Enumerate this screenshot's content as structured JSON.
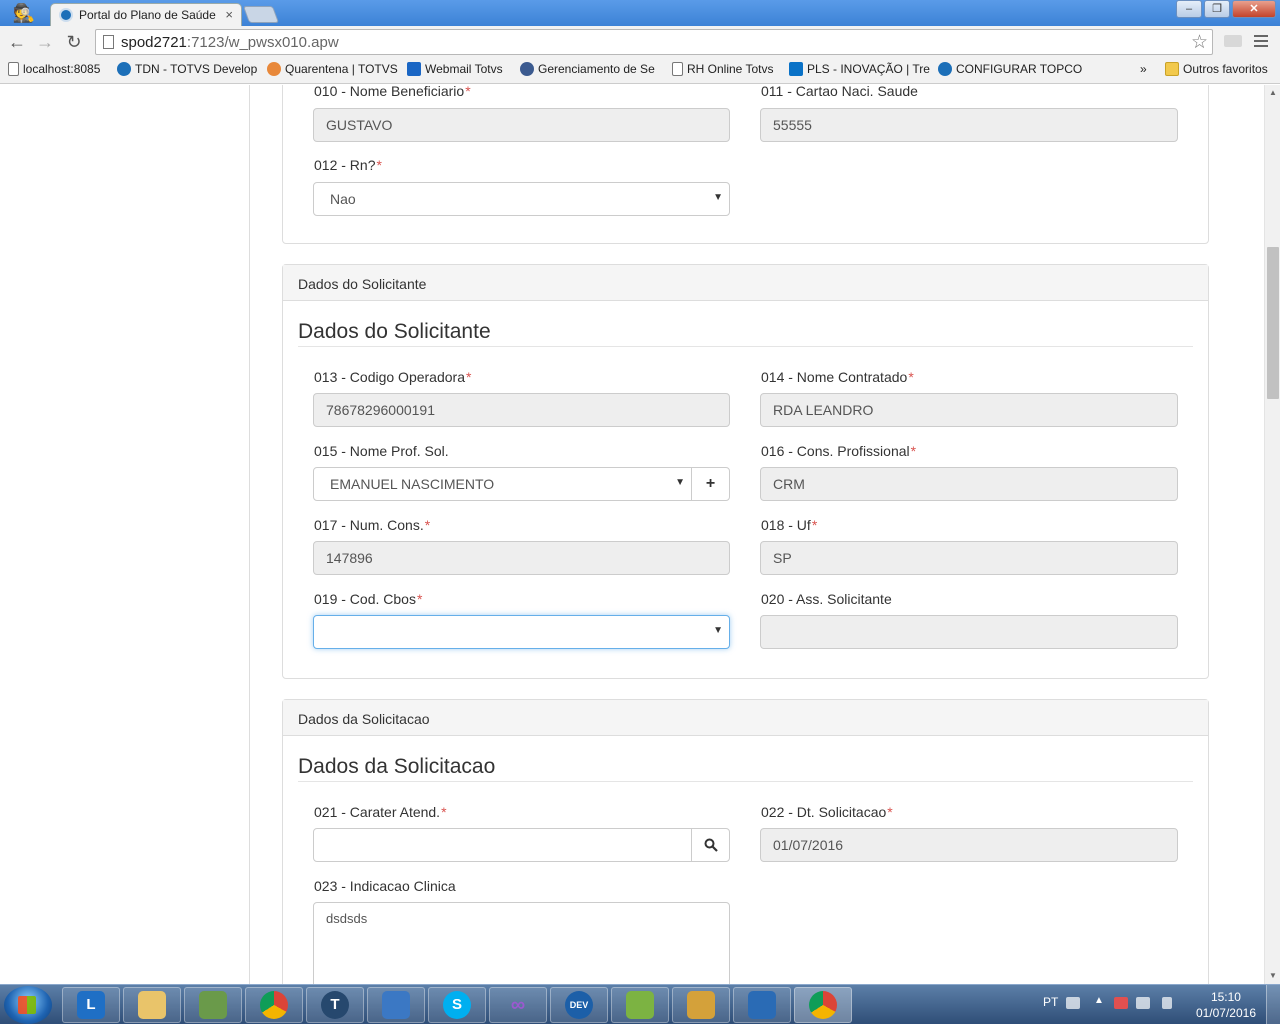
{
  "browser": {
    "tab_title": "Portal do Plano de Saúde",
    "tab_close": "×",
    "url_host": "spod2721",
    "url_path": ":7123/w_pwsx010.apw",
    "window_controls": {
      "minimize": "–",
      "restore": "❐",
      "close": "✕"
    }
  },
  "bookmarks": {
    "items": [
      {
        "label": "localhost:8085",
        "icon": "page-icon"
      },
      {
        "label": "TDN - TOTVS Develop",
        "icon": "tdn-icon"
      },
      {
        "label": "Quarentena | TOTVS",
        "icon": "quarantine-icon"
      },
      {
        "label": "Webmail Totvs",
        "icon": "outlook-icon"
      },
      {
        "label": "Gerenciamento de Se",
        "icon": "totvs-icon"
      },
      {
        "label": "RH Online Totvs",
        "icon": "page-icon"
      },
      {
        "label": "PLS - INOVAÇÃO | Tre",
        "icon": "trello-icon"
      },
      {
        "label": "CONFIGURAR TOPCO",
        "icon": "tdn-icon"
      }
    ],
    "overflow": "»",
    "other": "Outros favoritos"
  },
  "panel_beneficiario": {
    "f010": {
      "label": "010 - Nome Beneficiario",
      "required": "*",
      "value": "GUSTAVO"
    },
    "f011": {
      "label": "011 - Cartao Naci. Saude",
      "value": "55555"
    },
    "f012": {
      "label": "012 - Rn?",
      "required": "*",
      "value": "Nao"
    }
  },
  "panel_solicitante": {
    "heading": "Dados do Solicitante",
    "title": "Dados do Solicitante",
    "f013": {
      "label": "013 - Codigo Operadora",
      "required": "*",
      "value": "78678296000191"
    },
    "f014": {
      "label": "014 - Nome Contratado",
      "required": "*",
      "value": "RDA LEANDRO"
    },
    "f015": {
      "label": "015 - Nome Prof. Sol.",
      "value": "EMANUEL NASCIMENTO",
      "add_label": "+"
    },
    "f016": {
      "label": "016 - Cons. Profissional",
      "required": "*",
      "value": "CRM"
    },
    "f017": {
      "label": "017 - Num. Cons.",
      "required": "*",
      "value": "147896"
    },
    "f018": {
      "label": "018 - Uf",
      "required": "*",
      "value": "SP"
    },
    "f019": {
      "label": "019 - Cod. Cbos",
      "required": "*",
      "value": ""
    },
    "f020": {
      "label": "020 - Ass. Solicitante",
      "value": ""
    }
  },
  "panel_solicitacao": {
    "heading": "Dados da Solicitacao",
    "title": "Dados da Solicitacao",
    "f021": {
      "label": "021 - Carater Atend.",
      "required": "*",
      "value": ""
    },
    "f022": {
      "label": "022 - Dt. Solicitacao",
      "required": "*",
      "value": "01/07/2016"
    },
    "f023": {
      "label": "023 - Indicacao Clinica",
      "value": "dsdsds"
    }
  },
  "taskbar": {
    "items": [
      "lync-icon",
      "explorer-icon",
      "monitor-app-icon",
      "chrome-icon",
      "totvs-icon",
      "skype-icon",
      "infinity-icon",
      "dev-icon",
      "editor-icon",
      "tools-icon",
      "remote-desktop-icon",
      "chrome-icon"
    ],
    "lang": "PT",
    "time": "15:10",
    "date": "01/07/2016"
  }
}
